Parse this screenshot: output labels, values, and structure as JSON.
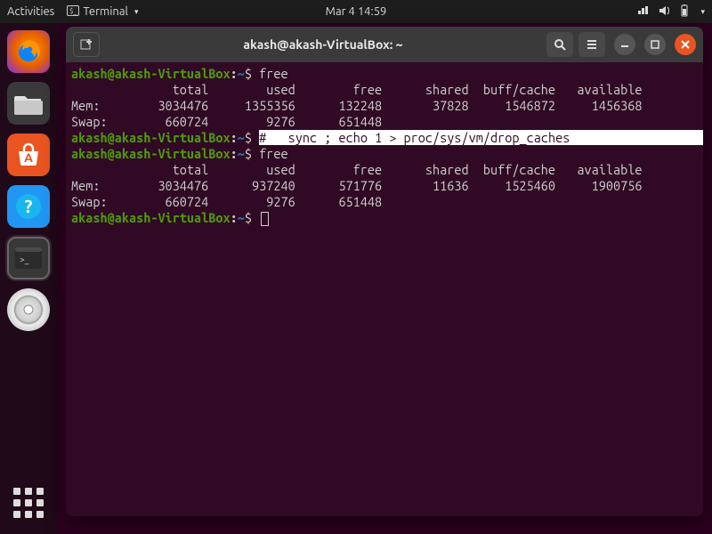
{
  "topbar": {
    "activities": "Activities",
    "app_indicator": "Terminal",
    "clock": "Mar 4  14:59"
  },
  "dock": {
    "items": [
      "firefox",
      "files",
      "software",
      "help",
      "terminal",
      "disk"
    ],
    "apps_label": "Show Applications"
  },
  "window": {
    "title": "akash@akash-VirtualBox: ~"
  },
  "term": {
    "prompt": {
      "user": "akash",
      "at": "@",
      "host": "akash-VirtualBox",
      "colon": ":",
      "path": "~",
      "dollar": "$"
    },
    "cmd1": "free",
    "free1": {
      "hdr": "              total        used        free      shared  buff/cache   available",
      "mem": "Mem:        3034476     1355356      132248       37828     1546872     1456368",
      "swap": "Swap:        660724        9276      651448"
    },
    "cmd2_highlight": "#   sync ; echo 1 > proc/sys/vm/drop_caches                                  ",
    "cmd3": "free",
    "free2": {
      "hdr": "              total        used        free      shared  buff/cache   available",
      "mem": "Mem:        3034476      937240      571776       11636     1525460     1900756",
      "swap": "Swap:        660724        9276      651448"
    }
  }
}
